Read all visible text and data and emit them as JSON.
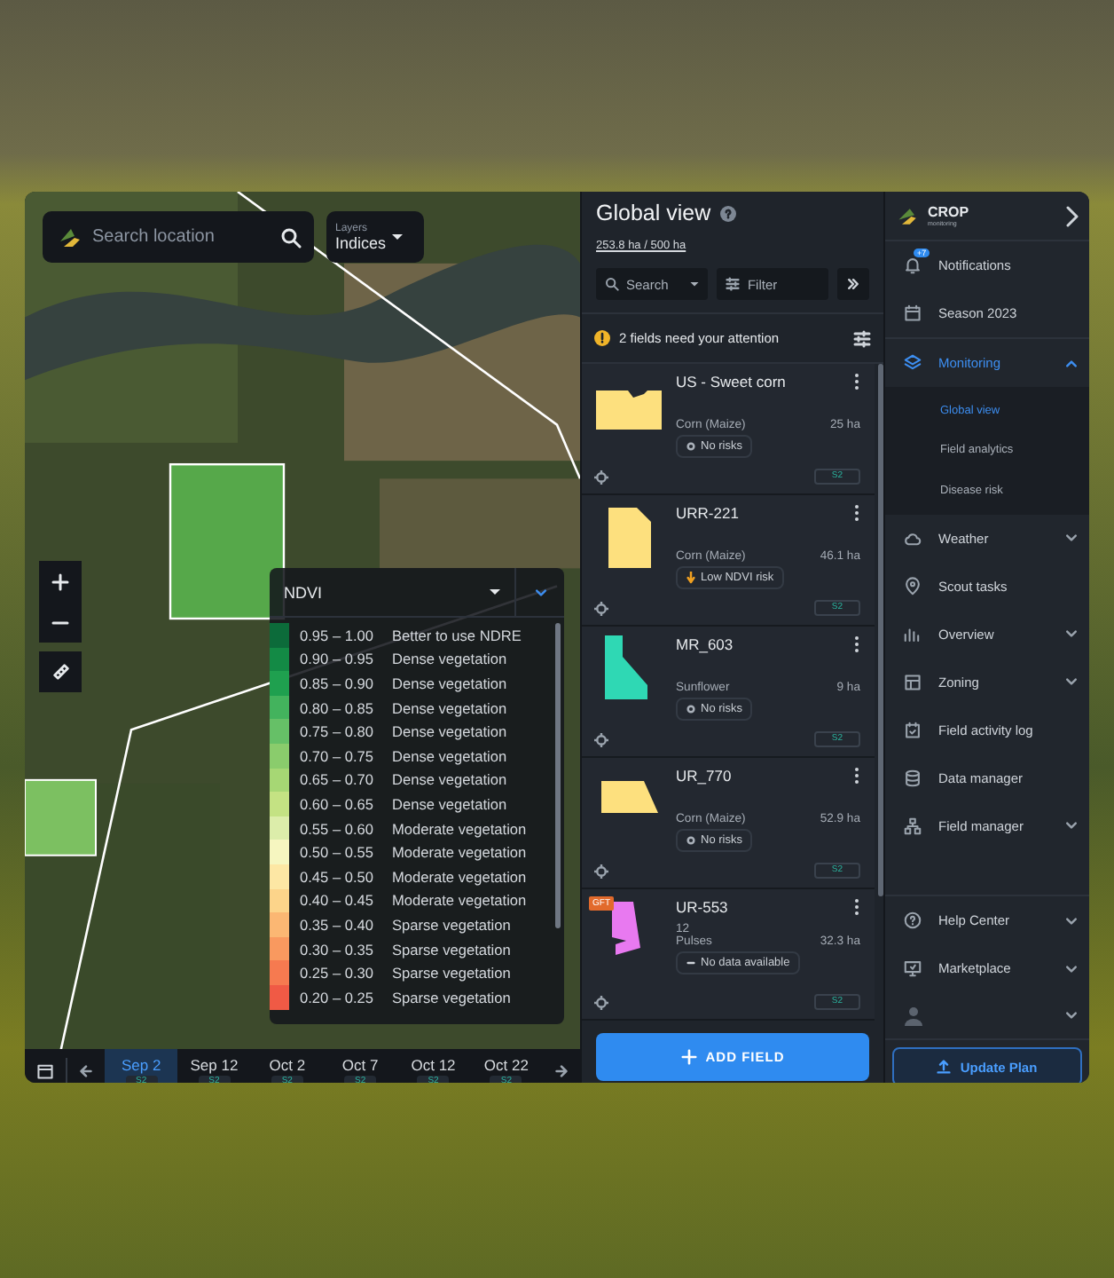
{
  "map": {
    "search": {
      "placeholder": "Search location"
    },
    "layers": {
      "label": "Layers",
      "value": "Indices"
    },
    "legend": {
      "index": "NDVI",
      "rows": [
        {
          "range": "0.95 – 1.00",
          "label": "Better to use NDRE",
          "color": "#0c6b3a"
        },
        {
          "range": "0.90 – 0.95",
          "label": "Dense vegetation",
          "color": "#138a45"
        },
        {
          "range": "0.85 – 0.90",
          "label": "Dense vegetation",
          "color": "#1fa04f"
        },
        {
          "range": "0.80 – 0.85",
          "label": "Dense vegetation",
          "color": "#43b35d"
        },
        {
          "range": "0.75 – 0.80",
          "label": "Dense vegetation",
          "color": "#66c067"
        },
        {
          "range": "0.70 – 0.75",
          "label": "Dense vegetation",
          "color": "#8acc6c"
        },
        {
          "range": "0.65 – 0.70",
          "label": "Dense vegetation",
          "color": "#a6d774"
        },
        {
          "range": "0.60 – 0.65",
          "label": "Dense vegetation",
          "color": "#c4e283"
        },
        {
          "range": "0.55 – 0.60",
          "label": "Moderate vegetation",
          "color": "#dcedaa"
        },
        {
          "range": "0.50 – 0.55",
          "label": "Moderate vegetation",
          "color": "#f6f6c0"
        },
        {
          "range": "0.45 – 0.50",
          "label": "Moderate vegetation",
          "color": "#fde7a4"
        },
        {
          "range": "0.40 – 0.45",
          "label": "Moderate vegetation",
          "color": "#fcd48a"
        },
        {
          "range": "0.35 – 0.40",
          "label": "Sparse vegetation",
          "color": "#fbb773"
        },
        {
          "range": "0.30 – 0.35",
          "label": "Sparse vegetation",
          "color": "#f9995f"
        },
        {
          "range": "0.25 – 0.30",
          "label": "Sparse vegetation",
          "color": "#f67a50"
        },
        {
          "range": "0.20 – 0.25",
          "label": "Sparse vegetation",
          "color": "#f05a45"
        }
      ]
    },
    "timeline": [
      {
        "date": "Sep 2",
        "source": "S2",
        "selected": true
      },
      {
        "date": "Sep 12",
        "source": "S2",
        "selected": false
      },
      {
        "date": "Oct 2",
        "source": "S2",
        "selected": false
      },
      {
        "date": "Oct 7",
        "source": "S2",
        "selected": false
      },
      {
        "date": "Oct 12",
        "source": "S2",
        "selected": false
      },
      {
        "date": "Oct 22",
        "source": "S2",
        "selected": false
      }
    ]
  },
  "panel": {
    "title": "Global view",
    "area": "253.8 ha / 500 ha",
    "search": "Search",
    "filter": "Filter",
    "alert": "2 fields need your attention",
    "fields": [
      {
        "name": "US - Sweet corn",
        "crop": "Corn (Maize)",
        "area": "25 ha",
        "risk": {
          "kind": "none",
          "label": "No risks"
        },
        "color": "#fde07e",
        "source": "S2"
      },
      {
        "name": "URR-221",
        "crop": "Corn (Maize)",
        "area": "46.1 ha",
        "risk": {
          "kind": "warning",
          "label": "Low NDVI risk"
        },
        "color": "#fde07e",
        "source": "S2"
      },
      {
        "name": "MR_603",
        "crop": "Sunflower",
        "area": "9 ha",
        "risk": {
          "kind": "none",
          "label": "No risks"
        },
        "color": "#2fd8b4",
        "source": "S2"
      },
      {
        "name": "UR_770",
        "crop": "Corn (Maize)",
        "area": "52.9 ha",
        "risk": {
          "kind": "none",
          "label": "No risks"
        },
        "color": "#fde07e",
        "source": "S2"
      },
      {
        "name": "UR-553",
        "tag": "GFT",
        "note": "12",
        "crop": "Pulses",
        "area": "32.3 ha",
        "risk": {
          "kind": "no_data",
          "label": "No data available"
        },
        "color": "#e879f0",
        "source": "S2"
      }
    ],
    "add_button": "ADD FIELD"
  },
  "sidebar": {
    "logo": {
      "name": "CROP",
      "subtitle": "monitoring"
    },
    "items": [
      {
        "label": "Notifications",
        "badge": "+7",
        "selected": false
      },
      {
        "label": "Season 2023",
        "selected": false
      },
      {
        "label": "Monitoring",
        "expanded": true,
        "selected": true,
        "children": [
          {
            "label": "Global view",
            "selected": true
          },
          {
            "label": "Field analytics",
            "selected": false
          },
          {
            "label": "Disease risk",
            "selected": false
          }
        ]
      },
      {
        "label": "Weather",
        "expanded": false,
        "selected": false
      },
      {
        "label": "Scout tasks",
        "selected": false
      },
      {
        "label": "Overview",
        "expanded": false,
        "selected": false
      },
      {
        "label": "Zoning",
        "expanded": false,
        "selected": false
      },
      {
        "label": "Field activity log",
        "selected": false
      },
      {
        "label": "Data manager",
        "selected": false
      },
      {
        "label": "Field manager",
        "expanded": false,
        "selected": false
      }
    ],
    "footer": [
      {
        "label": "Help Center",
        "expanded": false,
        "selected": false
      },
      {
        "label": "Marketplace",
        "expanded": false,
        "selected": false
      }
    ],
    "button": "Update Plan"
  }
}
